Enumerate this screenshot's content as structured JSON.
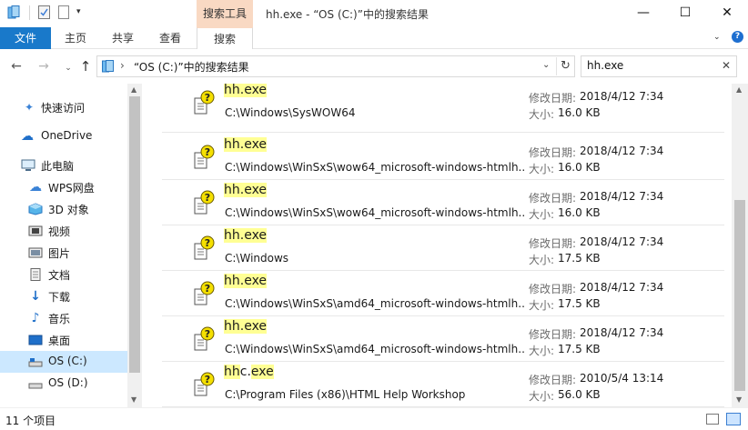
{
  "titlebar": {
    "context_tab": "搜索工具",
    "title": "hh.exe - “OS (C:)”中的搜索结果",
    "minimize": "—",
    "maximize": "☐",
    "close": "✕"
  },
  "ribbon": {
    "tabs": [
      {
        "label": "文件"
      },
      {
        "label": "主页"
      },
      {
        "label": "共享"
      },
      {
        "label": "查看"
      },
      {
        "label": "搜索"
      }
    ],
    "help": "?"
  },
  "address": {
    "path": "“OS (C:)”中的搜索结果",
    "search_value": "hh.exe"
  },
  "colors": {
    "accent": "#1979ca",
    "context_tab": "#f9d9c3",
    "highlight": "#ffff94",
    "selected": "#cce8ff"
  },
  "sidebar": {
    "items": [
      {
        "label": "快速访问",
        "icon": "pin-icon"
      },
      {
        "label": "OneDrive",
        "icon": "cloud-icon"
      },
      {
        "label": "此电脑",
        "icon": "computer-icon"
      },
      {
        "label": "WPS网盘",
        "icon": "cloud-outline-icon"
      },
      {
        "label": "3D 对象",
        "icon": "cube-icon"
      },
      {
        "label": "视频",
        "icon": "video-icon"
      },
      {
        "label": "图片",
        "icon": "picture-icon"
      },
      {
        "label": "文档",
        "icon": "document-icon"
      },
      {
        "label": "下载",
        "icon": "download-icon"
      },
      {
        "label": "音乐",
        "icon": "music-icon"
      },
      {
        "label": "桌面",
        "icon": "desktop-icon"
      },
      {
        "label": "OS (C:)",
        "icon": "drive-icon"
      },
      {
        "label": "OS (D:)",
        "icon": "drive-icon"
      }
    ]
  },
  "meta_labels": {
    "date": "修改日期:",
    "size": "大小:"
  },
  "results": [
    {
      "name_match": "hh.exe",
      "name_rest": "",
      "path": "C:\\Windows\\SysWOW64",
      "date": "2018/4/12 7:34",
      "size": "16.0 KB"
    },
    {
      "name_match": "hh.exe",
      "name_rest": "",
      "path": "C:\\Windows\\WinSxS\\wow64_microsoft-windows-htmlh...",
      "date": "2018/4/12 7:34",
      "size": "16.0 KB"
    },
    {
      "name_match": "hh.exe",
      "name_rest": "",
      "path": "C:\\Windows\\WinSxS\\wow64_microsoft-windows-htmlh...",
      "date": "2018/4/12 7:34",
      "size": "16.0 KB"
    },
    {
      "name_match": "hh.exe",
      "name_rest": "",
      "path": "C:\\Windows",
      "date": "2018/4/12 7:34",
      "size": "17.5 KB"
    },
    {
      "name_match": "hh.exe",
      "name_rest": "",
      "path": "C:\\Windows\\WinSxS\\amd64_microsoft-windows-htmlh...",
      "date": "2018/4/12 7:34",
      "size": "17.5 KB"
    },
    {
      "name_match": "hh.exe",
      "name_rest": "",
      "path": "C:\\Windows\\WinSxS\\amd64_microsoft-windows-htmlh...",
      "date": "2018/4/12 7:34",
      "size": "17.5 KB"
    },
    {
      "name_match": "hh",
      "name_mid": "c.",
      "name_rest": "exe",
      "path": "C:\\Program Files (x86)\\HTML Help Workshop",
      "date": "2010/5/4 13:14",
      "size": "56.0 KB"
    }
  ],
  "status": {
    "count": "11 个项目"
  }
}
